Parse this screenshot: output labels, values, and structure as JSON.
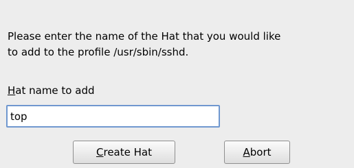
{
  "dialog": {
    "message_line1": "Please enter the name of the Hat that you would like",
    "message_line2": "to add to the profile /usr/sbin/sshd."
  },
  "hat_name": {
    "label_mnemonic": "H",
    "label_rest": "at name to add",
    "value": "top"
  },
  "buttons": {
    "create_mnemonic": "C",
    "create_rest": "reate Hat",
    "abort_mnemonic": "A",
    "abort_rest": "bort"
  }
}
